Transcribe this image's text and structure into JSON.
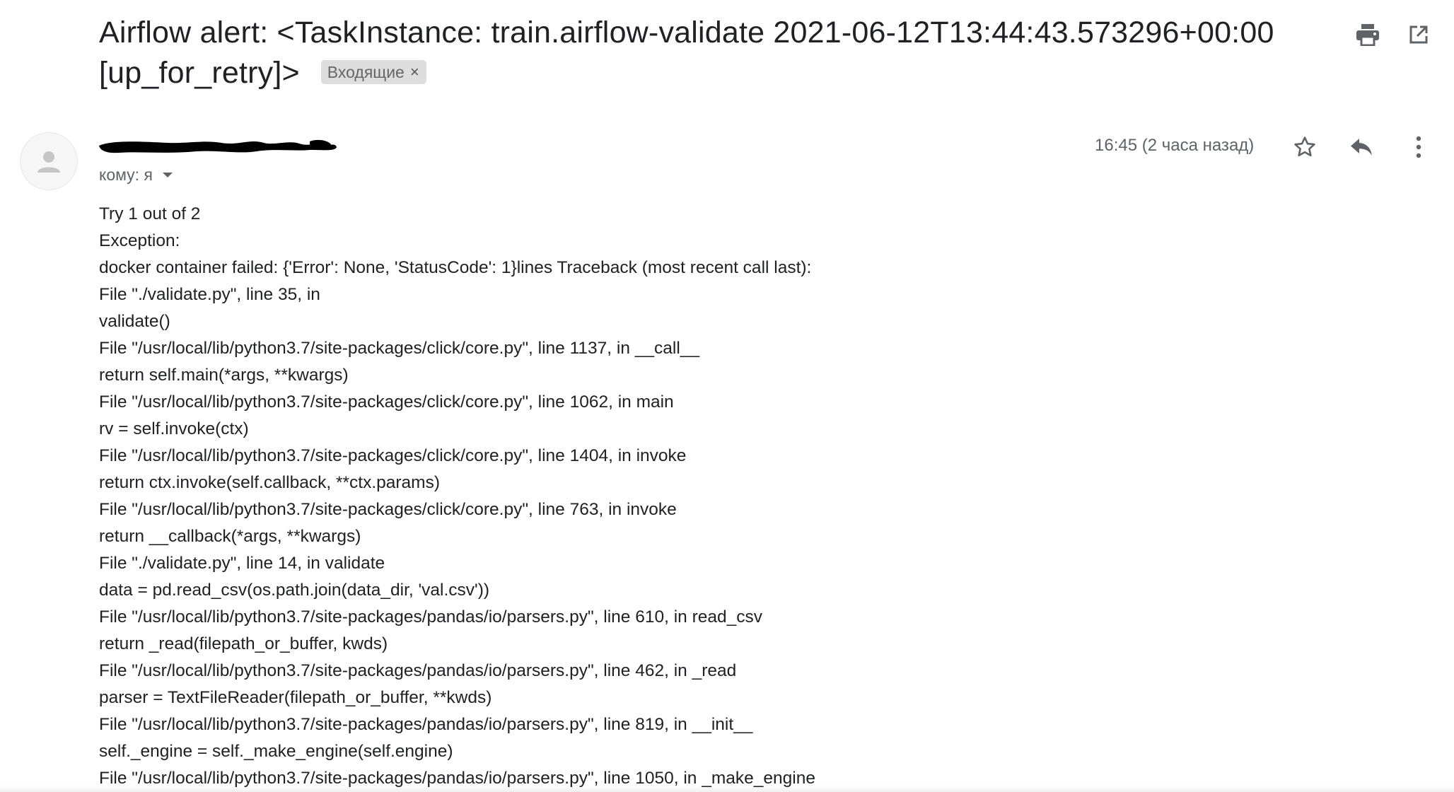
{
  "subject": {
    "text": "Airflow alert: <TaskInstance: train.airflow-validate 2021-06-12T13:44:43.573296+00:00 [up_for_retry]>",
    "label_chip": "Входящие",
    "label_chip_close": "×"
  },
  "header_icons": {
    "print": "print-icon",
    "popout": "open-in-new-window-icon"
  },
  "message": {
    "recipient": "кому: я",
    "timestamp": "16:45 (2 часа назад)",
    "icons": {
      "star": "star-icon",
      "reply": "reply-icon",
      "more": "more-vertical-icon",
      "avatar": "default-avatar-icon"
    }
  },
  "body_lines": [
    "Try 1 out of 2",
    "Exception:",
    "docker container failed: {'Error': None, 'StatusCode': 1}lines Traceback (most recent call last):",
    "File \"./validate.py\", line 35, in",
    "validate()",
    "File \"/usr/local/lib/python3.7/site-packages/click/core.py\", line 1137, in __call__",
    "return self.main(*args, **kwargs)",
    "File \"/usr/local/lib/python3.7/site-packages/click/core.py\", line 1062, in main",
    "rv = self.invoke(ctx)",
    "File \"/usr/local/lib/python3.7/site-packages/click/core.py\", line 1404, in invoke",
    "return ctx.invoke(self.callback, **ctx.params)",
    "File \"/usr/local/lib/python3.7/site-packages/click/core.py\", line 763, in invoke",
    "return __callback(*args, **kwargs)",
    "File \"./validate.py\", line 14, in validate",
    "data = pd.read_csv(os.path.join(data_dir, 'val.csv'))",
    "File \"/usr/local/lib/python3.7/site-packages/pandas/io/parsers.py\", line 610, in read_csv",
    "return _read(filepath_or_buffer, kwds)",
    "File \"/usr/local/lib/python3.7/site-packages/pandas/io/parsers.py\", line 462, in _read",
    "parser = TextFileReader(filepath_or_buffer, **kwds)",
    "File \"/usr/local/lib/python3.7/site-packages/pandas/io/parsers.py\", line 819, in __init__",
    "self._engine = self._make_engine(self.engine)",
    "File \"/usr/local/lib/python3.7/site-packages/pandas/io/parsers.py\", line 1050, in _make_engine"
  ],
  "colors": {
    "text": "#202124",
    "secondary": "#5f6368",
    "chip_bg": "#dddddd",
    "icon": "#5f6368"
  }
}
